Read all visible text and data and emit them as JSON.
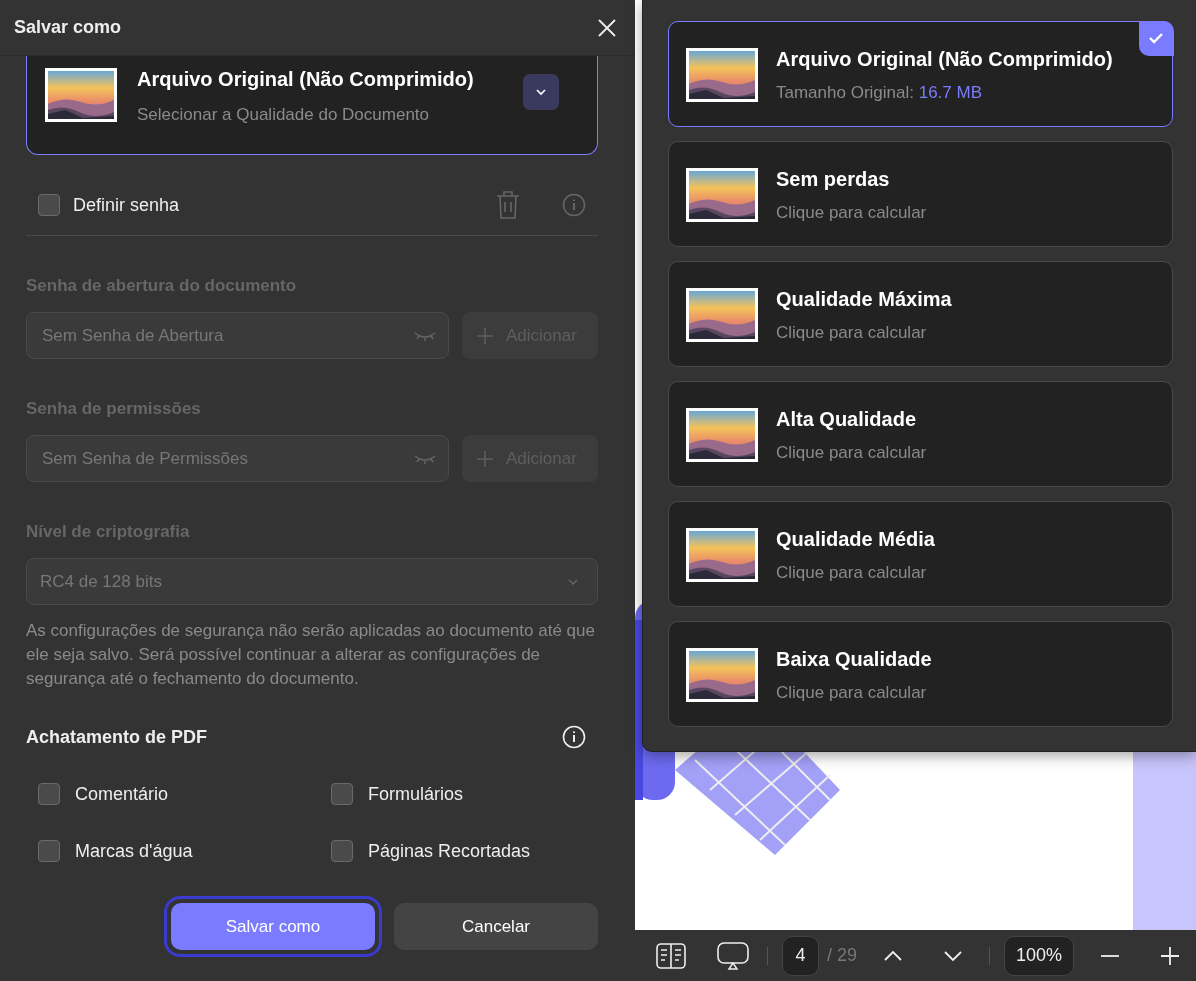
{
  "dialog": {
    "title": "Salvar como",
    "quality_card": {
      "title": "Arquivo Original (Não Comprimido)",
      "subtitle": "Selecionar a Qualidade do Documento"
    },
    "set_password": {
      "label": "Definir senha",
      "checked": false
    },
    "open_password": {
      "label": "Senha de abertura do documento",
      "placeholder": "Sem Senha de Abertura",
      "add_button": "Adicionar",
      "disabled": true
    },
    "permissions_password": {
      "label": "Senha de permissões",
      "placeholder": "Sem Senha de Permissões",
      "add_button": "Adicionar",
      "disabled": true
    },
    "encryption": {
      "label": "Nível de criptografia",
      "value": "RC4 de 128 bits",
      "disabled": true
    },
    "note": "As configurações de segurança não serão aplicadas ao documento até que ele seja salvo. Será possível continuar a alterar as configurações de segurança até o fechamento do documento.",
    "flattening": {
      "title": "Achatamento de PDF",
      "options": [
        {
          "label": "Comentário",
          "checked": false
        },
        {
          "label": "Formulários",
          "checked": false
        },
        {
          "label": "Marcas d'água",
          "checked": false
        },
        {
          "label": "Páginas Recortadas",
          "checked": false
        }
      ]
    },
    "buttons": {
      "save": "Salvar como",
      "cancel": "Cancelar"
    }
  },
  "quality_menu": {
    "options": [
      {
        "title": "Arquivo Original (Não Comprimido)",
        "subtitle": "Tamanho Original:",
        "size": "16.7 MB",
        "selected": true
      },
      {
        "title": "Sem perdas",
        "subtitle": "Clique para calcular",
        "selected": false
      },
      {
        "title": "Qualidade Máxima",
        "subtitle": "Clique para calcular",
        "selected": false
      },
      {
        "title": "Alta Qualidade",
        "subtitle": "Clique para calcular",
        "selected": false
      },
      {
        "title": "Qualidade Média",
        "subtitle": "Clique para calcular",
        "selected": false
      },
      {
        "title": "Baixa Qualidade",
        "subtitle": "Clique para calcular",
        "selected": false
      }
    ]
  },
  "toolbar": {
    "page": "4",
    "total": "/ 29",
    "zoom": "100%"
  }
}
